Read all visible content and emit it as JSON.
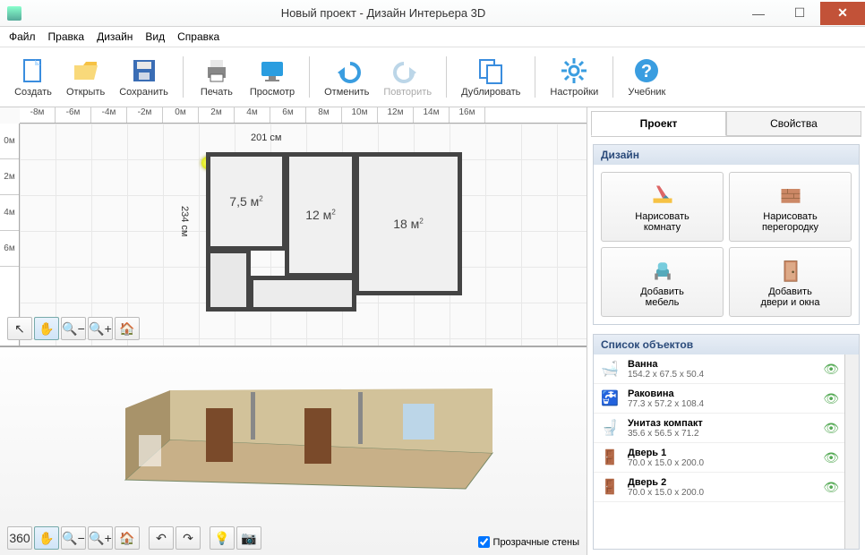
{
  "window": {
    "title": "Новый проект - Дизайн Интерьера 3D"
  },
  "menu": {
    "file": "Файл",
    "edit": "Правка",
    "design": "Дизайн",
    "view": "Вид",
    "help": "Справка"
  },
  "toolbar": {
    "create": "Создать",
    "open": "Открыть",
    "save": "Сохранить",
    "print": "Печать",
    "preview": "Просмотр",
    "undo": "Отменить",
    "redo": "Повторить",
    "duplicate": "Дублировать",
    "settings": "Настройки",
    "tutorial": "Учебник"
  },
  "ruler_h": [
    "-8м",
    "-6м",
    "-4м",
    "-2м",
    "0м",
    "2м",
    "4м",
    "6м",
    "8м",
    "10м",
    "12м",
    "14м",
    "16м"
  ],
  "ruler_v": [
    "0м",
    "2м",
    "4м",
    "6м"
  ],
  "floorplan": {
    "dim_w": "201 см",
    "dim_h": "234 см",
    "room1": "7,5 м",
    "room2": "12 м",
    "room3": "18 м"
  },
  "trans_walls": "Прозрачные стены",
  "tabs": {
    "project": "Проект",
    "props": "Свойства"
  },
  "sections": {
    "design": "Дизайн",
    "objects": "Список объектов"
  },
  "design_buttons": {
    "draw_room_l1": "Нарисовать",
    "draw_room_l2": "комнату",
    "draw_part_l1": "Нарисовать",
    "draw_part_l2": "перегородку",
    "add_furn_l1": "Добавить",
    "add_furn_l2": "мебель",
    "add_door_l1": "Добавить",
    "add_door_l2": "двери и окна"
  },
  "objects": [
    {
      "name": "Ванна",
      "dims": "154.2 x 67.5 x 50.4",
      "icon": "bath"
    },
    {
      "name": "Раковина",
      "dims": "77.3 x 57.2 x 108.4",
      "icon": "sink"
    },
    {
      "name": "Унитаз компакт",
      "dims": "35.6 x 56.5 x 71.2",
      "icon": "toilet"
    },
    {
      "name": "Дверь 1",
      "dims": "70.0 x 15.0 x 200.0",
      "icon": "door"
    },
    {
      "name": "Дверь 2",
      "dims": "70.0 x 15.0 x 200.0",
      "icon": "door"
    }
  ]
}
